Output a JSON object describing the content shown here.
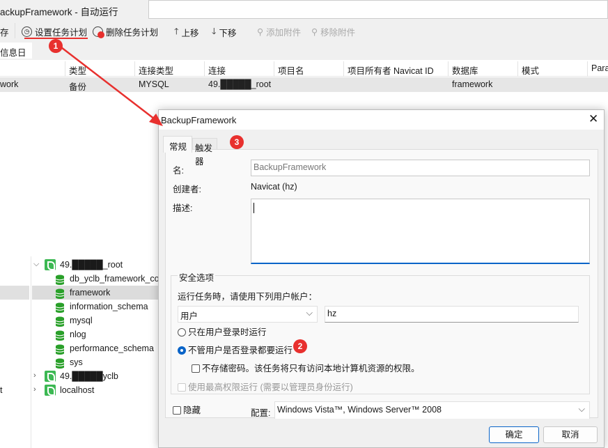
{
  "app": {
    "title": "ackupFramework - 自动运行"
  },
  "toolbar": {
    "save": "存",
    "set_schedule": "设置任务计划",
    "delete_schedule": "删除任务计划",
    "move_up": "上移",
    "move_down": "下移",
    "add_attachment": "添加附件",
    "remove_attachment": "移除附件"
  },
  "tabs": {
    "log": "信息日志"
  },
  "table": {
    "headers": [
      "类型",
      "连接类型",
      "连接",
      "项目名",
      "项目所有者 Navicat ID",
      "数据库",
      "模式",
      "Para"
    ],
    "row": {
      "name": "work",
      "type": "备份",
      "conn_type": "MYSQL",
      "conn": "49.█████_root",
      "project": "",
      "owner": "",
      "database": "framework",
      "schema": ""
    }
  },
  "tree": {
    "conn1": "49.█████_root",
    "dbs": [
      "db_yclb_framework_co",
      "framework",
      "information_schema",
      "mysql",
      "nlog",
      "performance_schema",
      "sys"
    ],
    "conn2": "49.█████yclb",
    "conn3": "localhost",
    "left_frag1": "t"
  },
  "dialog": {
    "title": "BackupFramework",
    "tabs": [
      "常规",
      "触发器"
    ],
    "name_label": "名:",
    "name_value": "BackupFramework",
    "creator_label": "创建者:",
    "creator_value": "Navicat (hz)",
    "desc_label": "描述:",
    "security": {
      "legend": "安全选项",
      "prompt": "运行任务時，请使用下列用户帐户：",
      "account_type": "用户",
      "account": "hz",
      "radio_logged_on": "只在用户登录时运行",
      "radio_always": "不管用户是否登录都要运行",
      "no_store_pw": "不存储密码。该任务将只有访问本地计算机资源的权限。",
      "highest": "使用最高权限运行 (需要以管理员身份运行)"
    },
    "hidden": "隐藏",
    "config_label": "配置:",
    "config_value": "Windows Vista™, Windows Server™ 2008",
    "ok": "确定",
    "cancel": "取消"
  },
  "annotations": {
    "b1": "1",
    "b2": "2",
    "b3": "3"
  },
  "colors": {
    "annotation": "#e8302e",
    "accent": "#0a64c8",
    "db_icon": "#2aa02a"
  }
}
